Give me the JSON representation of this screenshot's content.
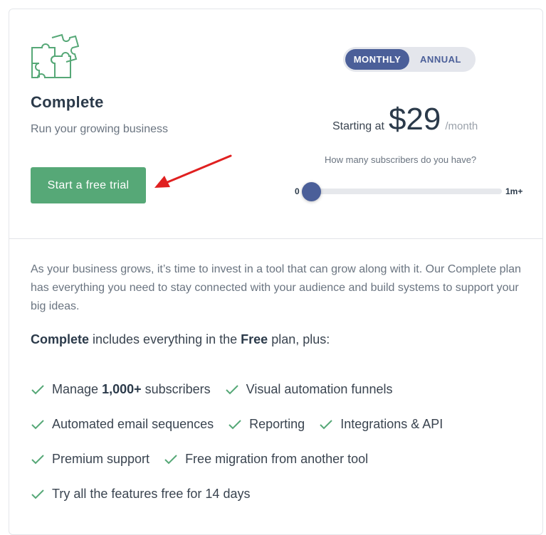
{
  "plan": {
    "name": "Complete",
    "tagline": "Run your growing business",
    "cta_label": "Start a free trial"
  },
  "billing_toggle": {
    "monthly": "MONTHLY",
    "annual": "ANNUAL",
    "selected": "MONTHLY"
  },
  "pricing": {
    "prefix": "Starting at",
    "amount": "$29",
    "suffix": "/month"
  },
  "subscribers_slider": {
    "question": "How many subscribers do you have?",
    "min_label": "0",
    "max_label": "1m+",
    "value_fraction": 0
  },
  "description": "As your business grows, it’s time to invest in a tool that can grow along with it. Our Complete plan has everything you need to stay connected with your audience and build systems to support your big ideas.",
  "includes": {
    "plan_bold": "Complete",
    "middle": " includes everything in the ",
    "free_bold": "Free",
    "end": " plan, plus:"
  },
  "features": {
    "manage_prefix": "Manage ",
    "manage_bold": "1,000+",
    "manage_suffix": " subscribers",
    "visual_automation": "Visual automation funnels",
    "automated_email": "Automated email sequences",
    "reporting": "Reporting",
    "integrations": "Integrations & API",
    "premium_support": "Premium support",
    "free_migration": "Free migration from another tool",
    "trial": "Try all the features free for 14 days"
  },
  "colors": {
    "accent_green": "#56a877",
    "toggle_blue": "#4b5f99",
    "annotation_arrow": "#e02020"
  },
  "icons": {
    "logo": "puzzle-pieces-icon",
    "feature_bullet": "checkmark-icon",
    "annotation": "red-arrow-icon"
  }
}
